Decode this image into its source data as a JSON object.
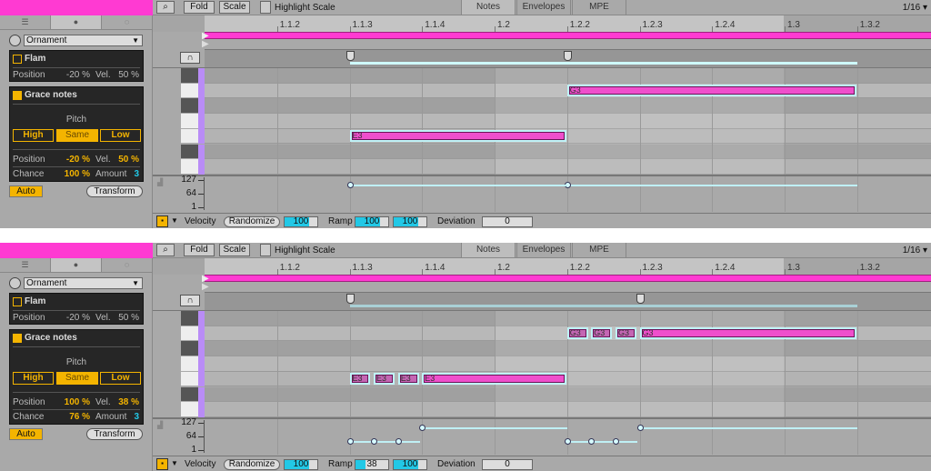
{
  "colors": {
    "clip": "#ff3ad2",
    "accent": "#f4b400",
    "note": "#ef4fcc",
    "grace_note": "#c466b4",
    "velocity": "#bff0f5",
    "value_cyan": "#22c8e6"
  },
  "panels": [
    {
      "device": {
        "tab_icons": [
          "sliders-icon",
          "ornament-icon",
          "target-icon"
        ],
        "mode": "Ornament",
        "flam": {
          "label": "Flam",
          "enabled": false,
          "position_label": "Position",
          "position": "-20 %",
          "vel_label": "Vel.",
          "vel": "50 %"
        },
        "grace": {
          "label": "Grace notes",
          "enabled": true,
          "pitch_label": "Pitch",
          "pitch_options": [
            "High",
            "Same",
            "Low"
          ],
          "pitch_selected": "Same",
          "position_label": "Position",
          "position": "-20 %",
          "vel_label": "Vel.",
          "vel": "50 %",
          "chance_label": "Chance",
          "chance": "100 %",
          "amount_label": "Amount",
          "amount": "3"
        },
        "auto": "Auto",
        "transform": "Transform"
      },
      "toolbar": {
        "fold": "Fold",
        "scale": "Scale",
        "highlight": "Highlight Scale",
        "tabs": [
          "Notes",
          "Envelopes",
          "MPE"
        ],
        "active_tab": "Notes",
        "grid": "1/16 ▾"
      },
      "ruler": [
        "1.1.2",
        "1.1.3",
        "1.1.4",
        "1.2",
        "1.2.2",
        "1.2.3",
        "1.2.4",
        "1.3",
        "1.3.2"
      ],
      "markers": [
        2,
        5
      ],
      "notes": [
        {
          "pitch": "G3",
          "start": 5,
          "length": 4,
          "velocity": 100,
          "grace": false
        },
        {
          "pitch": "E3",
          "start": 2,
          "length": 3,
          "velocity": 100,
          "grace": false
        }
      ],
      "velocity_axis": [
        "127",
        "64",
        "1"
      ],
      "bottom": {
        "velocity_label": "Velocity",
        "randomize": "Randomize",
        "velocity": "100",
        "ramp_label": "Ramp",
        "ramp_start": "100",
        "ramp_end": "100",
        "deviation_label": "Deviation",
        "deviation": "0"
      }
    },
    {
      "device": {
        "tab_icons": [
          "sliders-icon",
          "ornament-icon",
          "target-icon"
        ],
        "mode": "Ornament",
        "flam": {
          "label": "Flam",
          "enabled": false,
          "position_label": "Position",
          "position": "-20 %",
          "vel_label": "Vel.",
          "vel": "50 %"
        },
        "grace": {
          "label": "Grace notes",
          "enabled": true,
          "pitch_label": "Pitch",
          "pitch_options": [
            "High",
            "Same",
            "Low"
          ],
          "pitch_selected": "Same",
          "position_label": "Position",
          "position": "100 %",
          "vel_label": "Vel.",
          "vel": "38 %",
          "chance_label": "Chance",
          "chance": "76 %",
          "amount_label": "Amount",
          "amount": "3"
        },
        "auto": "Auto",
        "transform": "Transform"
      },
      "toolbar": {
        "fold": "Fold",
        "scale": "Scale",
        "highlight": "Highlight Scale",
        "tabs": [
          "Notes",
          "Envelopes",
          "MPE"
        ],
        "active_tab": "Notes",
        "grid": "1/16 ▾"
      },
      "ruler": [
        "1.1.2",
        "1.1.3",
        "1.1.4",
        "1.2",
        "1.2.2",
        "1.2.3",
        "1.2.4",
        "1.3",
        "1.3.2"
      ],
      "markers": [
        2,
        6
      ],
      "notes": [
        {
          "pitch": "G3",
          "start": 5,
          "length": 0.3,
          "velocity": 38,
          "grace": true
        },
        {
          "pitch": "G3",
          "start": 5.333,
          "length": 0.3,
          "velocity": 38,
          "grace": true
        },
        {
          "pitch": "G3",
          "start": 5.667,
          "length": 0.3,
          "velocity": 38,
          "grace": true
        },
        {
          "pitch": "G3",
          "start": 6,
          "length": 3,
          "velocity": 100,
          "grace": false
        },
        {
          "pitch": "E3",
          "start": 2,
          "length": 0.3,
          "velocity": 38,
          "grace": true
        },
        {
          "pitch": "E3",
          "start": 2.333,
          "length": 0.3,
          "velocity": 38,
          "grace": true
        },
        {
          "pitch": "E3",
          "start": 2.667,
          "length": 0.3,
          "velocity": 38,
          "grace": true
        },
        {
          "pitch": "E3",
          "start": 3,
          "length": 2,
          "velocity": 100,
          "grace": false
        }
      ],
      "velocity_axis": [
        "127",
        "64",
        "1"
      ],
      "bottom": {
        "velocity_label": "Velocity",
        "randomize": "Randomize",
        "velocity": "100",
        "ramp_label": "Ramp",
        "ramp_start": "38",
        "ramp_end": "100",
        "deviation_label": "Deviation",
        "deviation": "0"
      }
    }
  ]
}
